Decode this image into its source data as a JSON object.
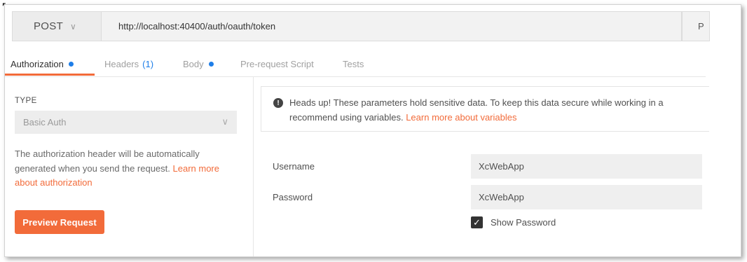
{
  "request": {
    "method": "POST",
    "url": "http://localhost:40400/auth/oauth/token",
    "params_label": "P"
  },
  "tabs": [
    {
      "label": "Authorization",
      "active": true,
      "dot": true
    },
    {
      "label": "Headers",
      "count": "(1)"
    },
    {
      "label": "Body",
      "dot": true
    },
    {
      "label": "Pre-request Script"
    },
    {
      "label": "Tests"
    }
  ],
  "auth": {
    "type_label": "TYPE",
    "selected_type": "Basic Auth",
    "description": "The authorization header will be automatically generated when you send the request.",
    "learn_more_link": "Learn more about authorization",
    "preview_button": "Preview Request"
  },
  "notice": {
    "line1": "Heads up! These parameters hold sensitive data. To keep this data secure while working in a",
    "line2_prefix": "recommend using variables.",
    "link": "Learn more about variables"
  },
  "fields": {
    "username_label": "Username",
    "username_value": "XcWebApp",
    "password_label": "Password",
    "password_value": "XcWebApp",
    "show_password_label": "Show Password",
    "show_password_checked": true
  },
  "colors": {
    "accent": "#f26b3a",
    "blue": "#1e7ee8"
  }
}
